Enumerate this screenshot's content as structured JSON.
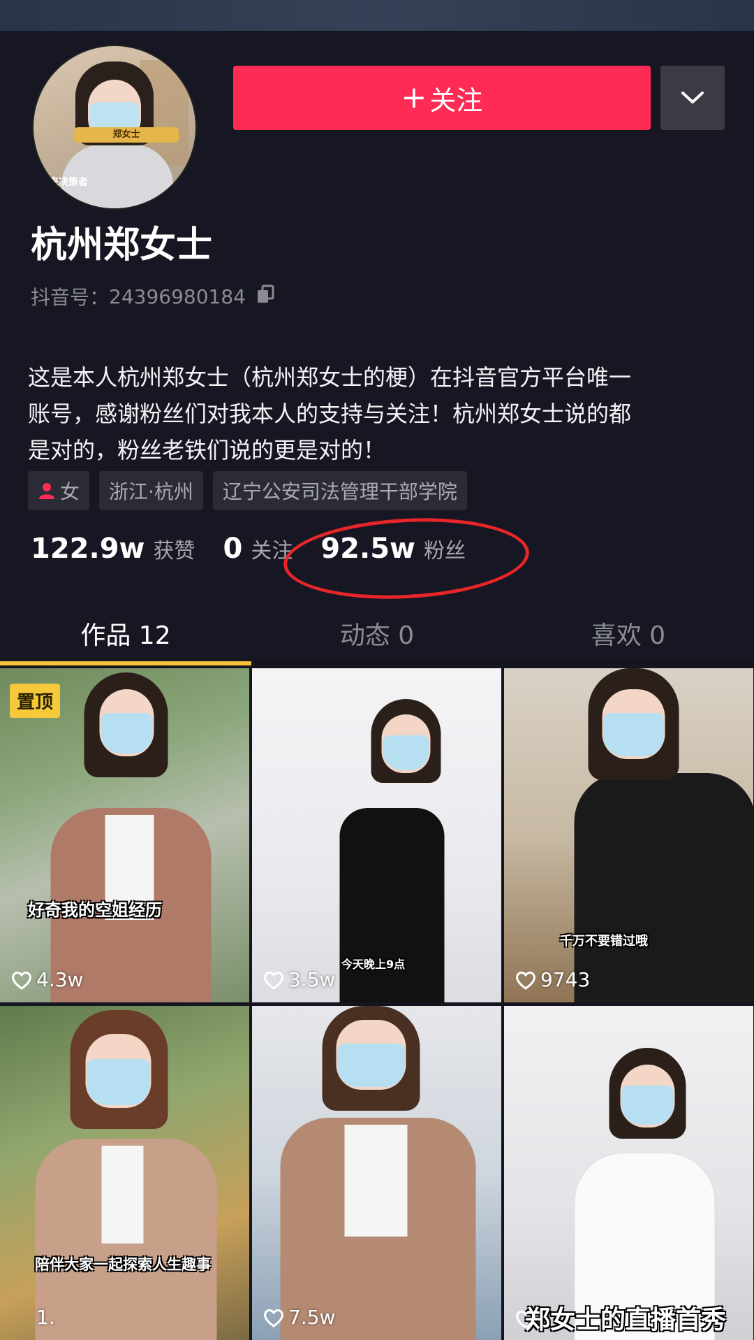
{
  "profile": {
    "avatar_tag": "郑女士",
    "avatar_caption": "来决策者",
    "follow_label": "关注",
    "follow_plus": "+",
    "name": "杭州郑女士",
    "id_label": "抖音号：",
    "id_value": "24396980184",
    "bio_lines": [
      "这是本人杭州郑女士（杭州郑女士的梗）在抖音官方平台唯一",
      "账号，感谢粉丝们对我本人的支持与关注！杭州郑女士说的都",
      "是对的，粉丝老铁们说的更是对的！"
    ],
    "tags": {
      "gender": "女",
      "location": "浙江·杭州",
      "school": "辽宁公安司法管理干部学院"
    }
  },
  "stats": [
    {
      "num": "122.9w",
      "label": "获赞"
    },
    {
      "num": "0",
      "label": "关注"
    },
    {
      "num": "92.5w",
      "label": "粉丝"
    }
  ],
  "tabs": [
    {
      "label": "作品 12"
    },
    {
      "label": "动态 0"
    },
    {
      "label": "喜欢 0"
    }
  ],
  "videos": [
    {
      "pinned_label": "置顶",
      "caption": "好奇我的空姐经历",
      "likes": "4.3w"
    },
    {
      "caption": "今天晚上9点",
      "likes": "3.5w"
    },
    {
      "caption": "千万不要错过哦",
      "likes": "9743"
    },
    {
      "caption": "陪伴大家一起探索人生趣事",
      "likes": "1."
    },
    {
      "caption": "",
      "likes": "7.5w"
    },
    {
      "caption": "郑女士的直播首秀",
      "likes": ""
    }
  ],
  "colors": {
    "accent": "#fe2c55",
    "background": "#161722",
    "tab_indicator": "#f6c33a",
    "annotation_circle": "#e8262a"
  }
}
